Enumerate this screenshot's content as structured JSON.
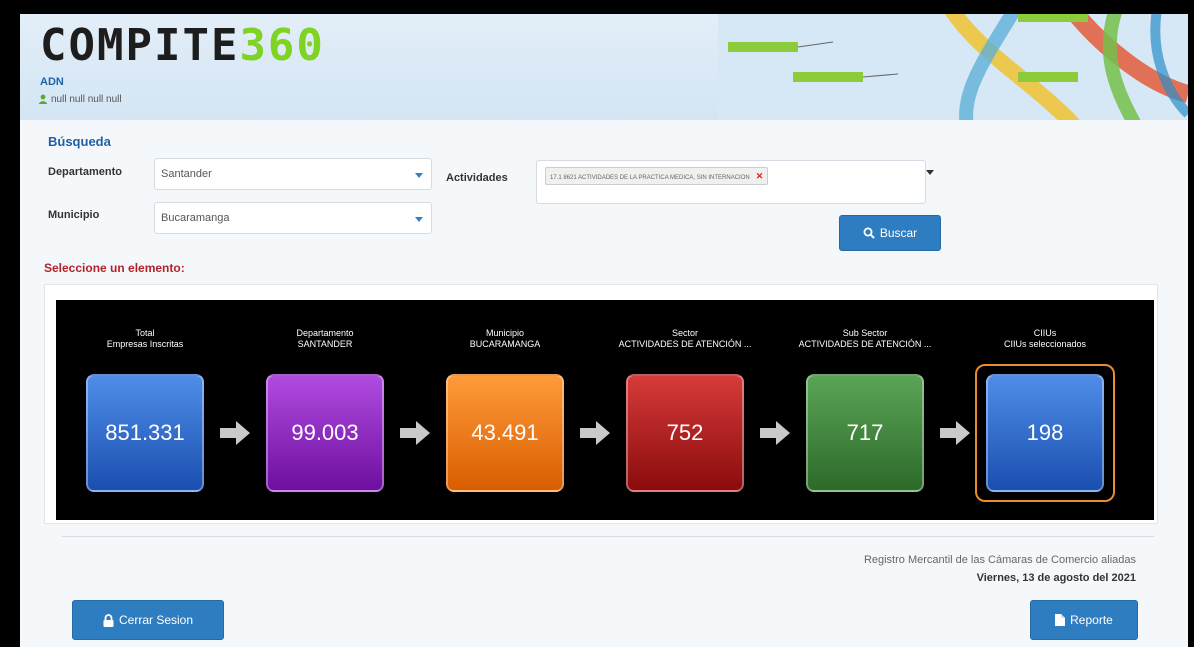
{
  "header": {
    "logo_part1": "COMPITE",
    "logo_part2": "360",
    "section": "ADN",
    "user": "null null null null"
  },
  "search": {
    "title": "Búsqueda",
    "departamento_label": "Departamento",
    "departamento_value": "Santander",
    "municipio_label": "Municipio",
    "municipio_value": "Bucaramanga",
    "actividades_label": "Actividades",
    "actividad_tag": "17.1 8621 ACTIVIDADES DE LA PRACTICA MEDICA, SIN INTERNACION",
    "buscar_label": "Buscar"
  },
  "select_prompt": "Seleccione un elemento:",
  "stages": [
    {
      "line1": "Total",
      "line2": "Empresas Inscritas",
      "value": "851.331",
      "color": "blue"
    },
    {
      "line1": "Departamento",
      "line2": "SANTANDER",
      "value": "99.003",
      "color": "purple"
    },
    {
      "line1": "Municipio",
      "line2": "BUCARAMANGA",
      "value": "43.491",
      "color": "orange"
    },
    {
      "line1": "Sector",
      "line2": "ACTIVIDADES DE ATENCIÓN ...",
      "value": "752",
      "color": "red"
    },
    {
      "line1": "Sub Sector",
      "line2": "ACTIVIDADES DE ATENCIÓN ...",
      "value": "717",
      "color": "green"
    },
    {
      "line1": "CIIUs",
      "line2": "CIIUs seleccionados",
      "value": "198",
      "color": "blue",
      "selected": true
    }
  ],
  "footer": {
    "registro": "Registro Mercantil de las Cámaras de Comercio aliadas",
    "fecha": "Viernes, 13 de agosto del 2021",
    "cerrar_label": "Cerrar Sesion",
    "reporte_label": "Reporte"
  },
  "colors": {
    "accent": "#2f7dc1",
    "blue": "#2a63c9",
    "purple": "#8f1fc4",
    "orange": "#f07a10",
    "red": "#b81818",
    "green": "#3f8a3a",
    "selected_ring": "#e88d2a"
  }
}
